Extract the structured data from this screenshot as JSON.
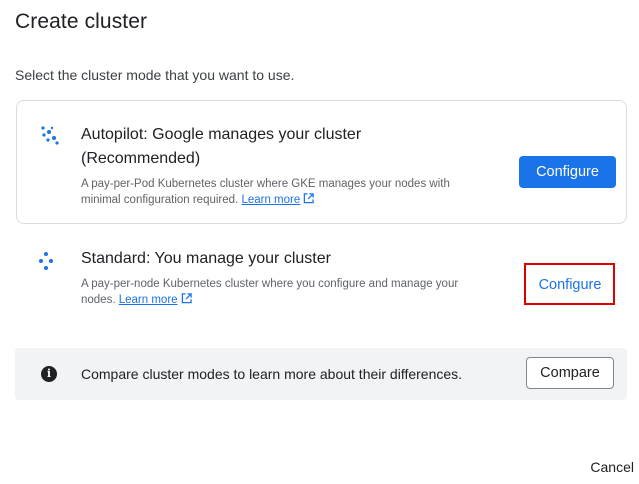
{
  "dialog": {
    "title": "Create cluster",
    "subtitle": "Select the cluster mode that you want to use.",
    "cancel_label": "Cancel"
  },
  "options": [
    {
      "title_line1": "Autopilot: Google manages your cluster",
      "title_line2": "(Recommended)",
      "desc_line1": "A pay-per-Pod Kubernetes cluster where GKE manages your nodes with",
      "desc_line2": "minimal configuration required.",
      "learn_more": "Learn more",
      "configure_label": "Configure",
      "icon": "autopilot-sparkle-icon"
    },
    {
      "title_line1": "Standard: You manage your cluster",
      "desc_line1": "A pay-per-node Kubernetes cluster where you configure and manage your",
      "desc_line2": "nodes.",
      "learn_more": "Learn more",
      "configure_label": "Configure",
      "icon": "standard-nodes-icon"
    }
  ],
  "compare": {
    "text": "Compare cluster modes to learn more about their differences.",
    "button_label": "Compare",
    "icon": "info-icon"
  },
  "colors": {
    "accent": "#1a73e8",
    "highlight": "#e00000",
    "info_background": "#f1f3f4"
  }
}
